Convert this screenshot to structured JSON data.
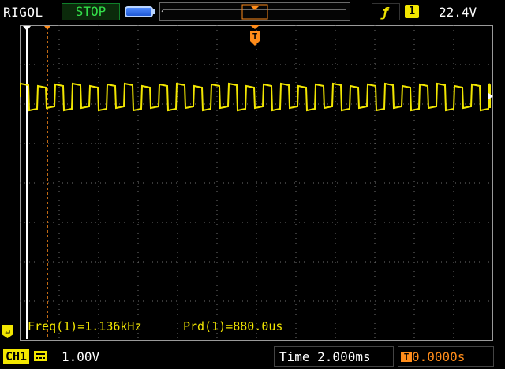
{
  "header": {
    "brand": "RIGOL",
    "run_status": "STOP",
    "trigger_source": "1",
    "trigger_level": "22.4V"
  },
  "icons": {
    "memory": "memory-depth-icon",
    "trigger_slope": "rising-edge-icon",
    "trigger_marker": "trigger-position-icon",
    "trigger_offset": "trigger-offset-icon",
    "coupling": "dc-coupling-icon",
    "ground": "ch1-ground-marker-icon"
  },
  "trigger": {
    "marker_label": "T"
  },
  "measurements": {
    "freq": "Freq(1)=1.136kHz",
    "prd": "Prd(1)=880.0us"
  },
  "channel": {
    "label": "CH1",
    "scale": "1.00V"
  },
  "timebase": {
    "scale": "Time 2.000ms",
    "trigger_offset": "0.0000s",
    "offset_icon_text": "T"
  },
  "colors": {
    "trace": "#f2e600",
    "trigger": "#ff8c1a",
    "grid": "#8a8a8a",
    "status": "#33e04a"
  }
}
